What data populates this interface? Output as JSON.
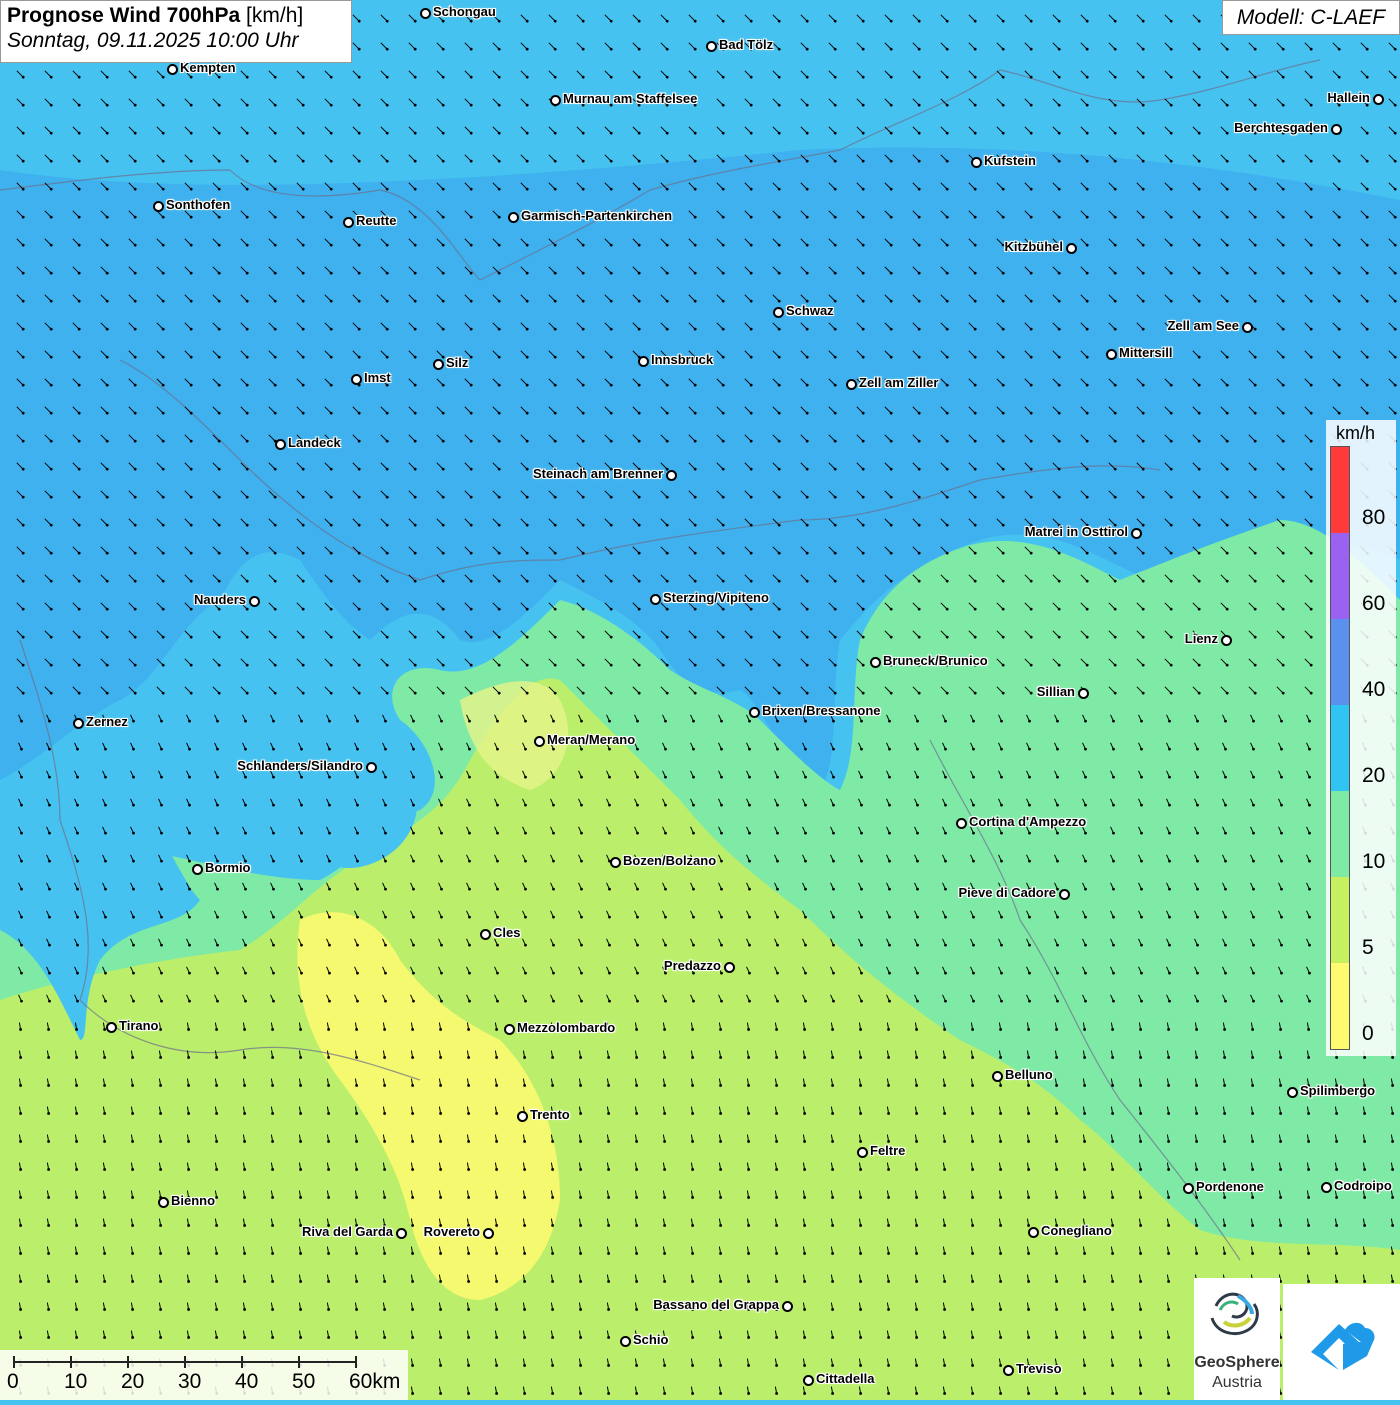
{
  "title": {
    "main": "Prognose Wind 700hPa",
    "unit": "[km/h]",
    "datetime": "Sonntag, 09.11.2025 10:00 Uhr"
  },
  "model_label": "Modell: C-LAEF",
  "legend": {
    "unit": "km/h",
    "labels": [
      "80",
      "60",
      "40",
      "20",
      "10",
      "5",
      "0"
    ],
    "colors": [
      "#ff3a3a",
      "#9a62f0",
      "#5a90ee",
      "#30c4f2",
      "#7eeaa6",
      "#c6f060",
      "#fffa70"
    ]
  },
  "scale_bar": {
    "labels": [
      "0",
      "10",
      "20",
      "30",
      "40",
      "50",
      "60km"
    ]
  },
  "cities": [
    {
      "name": "Schongau"
    },
    {
      "name": "Bad Tölz"
    },
    {
      "name": "Kempten"
    },
    {
      "name": "Murnau am Staffelsee"
    },
    {
      "name": "Hallein"
    },
    {
      "name": "Berchtesgaden"
    },
    {
      "name": "Kufstein"
    },
    {
      "name": "Sonthofen"
    },
    {
      "name": "Reutte"
    },
    {
      "name": "Garmisch-Partenkirchen"
    },
    {
      "name": "Kitzbühel"
    },
    {
      "name": "Schwaz"
    },
    {
      "name": "Zell am See"
    },
    {
      "name": "Mittersill"
    },
    {
      "name": "Innsbruck"
    },
    {
      "name": "Silz"
    },
    {
      "name": "Imst"
    },
    {
      "name": "Zell am Ziller"
    },
    {
      "name": "Landeck"
    },
    {
      "name": "Steinach am Brenner"
    },
    {
      "name": "Matrei in Osttirol"
    },
    {
      "name": "Nauders"
    },
    {
      "name": "Sterzing/Vipiteno"
    },
    {
      "name": "Lienz"
    },
    {
      "name": "Bruneck/Brunico"
    },
    {
      "name": "Sillian"
    },
    {
      "name": "Brixen/Bressanone"
    },
    {
      "name": "Zernez"
    },
    {
      "name": "Meran/Merano"
    },
    {
      "name": "Schlanders/Silandro"
    },
    {
      "name": "Cortina d'Ampezzo"
    },
    {
      "name": "Bozen/Bolzano"
    },
    {
      "name": "Bormio"
    },
    {
      "name": "Pieve di Cadore"
    },
    {
      "name": "Cles"
    },
    {
      "name": "Predazzo"
    },
    {
      "name": "Tirano"
    },
    {
      "name": "Mezzolombardo"
    },
    {
      "name": "Belluno"
    },
    {
      "name": "Spilimbergo"
    },
    {
      "name": "Trento"
    },
    {
      "name": "Feltre"
    },
    {
      "name": "Bienno"
    },
    {
      "name": "Pordenone"
    },
    {
      "name": "Codroipo"
    },
    {
      "name": "Riva del Garda"
    },
    {
      "name": "Rovereto"
    },
    {
      "name": "Conegliano"
    },
    {
      "name": "Bassano del Grappa"
    },
    {
      "name": "Schio"
    },
    {
      "name": "Treviso"
    },
    {
      "name": "Cittadella"
    }
  ],
  "logos": {
    "geosphere_name": "GeoSphere",
    "geosphere_sub": "Austria"
  }
}
